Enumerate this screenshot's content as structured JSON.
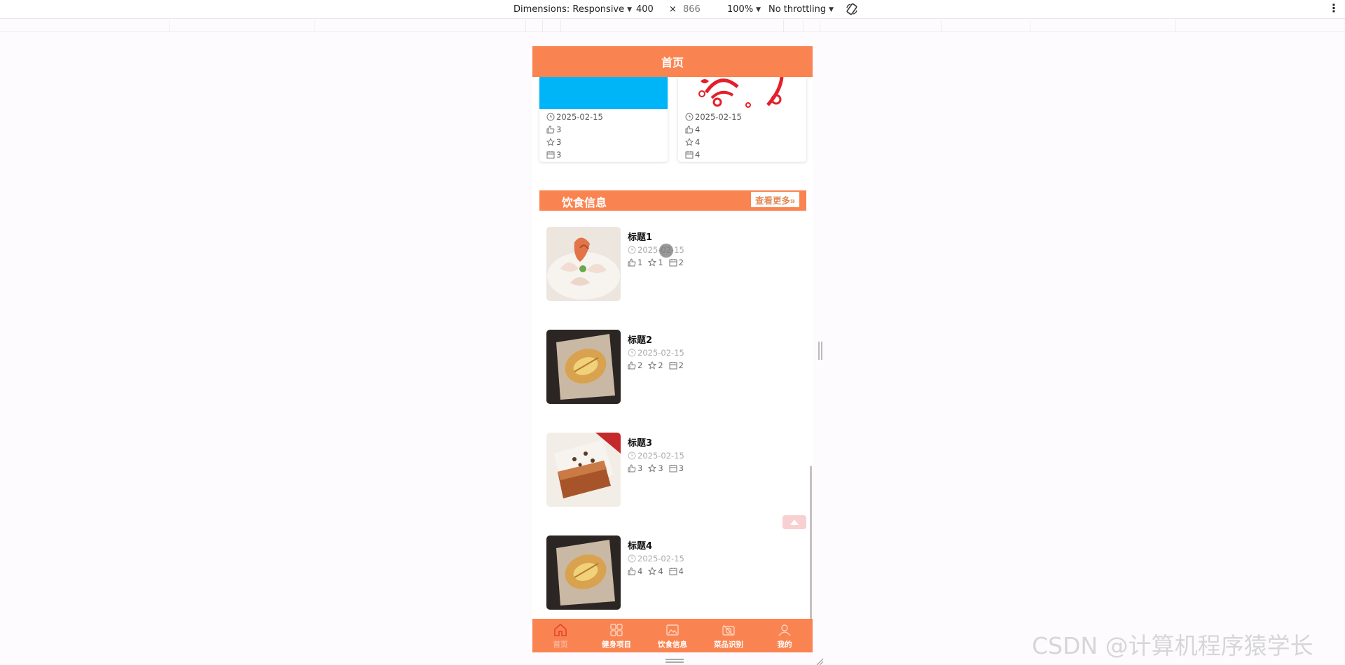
{
  "devtools": {
    "dimensions_label": "Dimensions: Responsive",
    "width": "400",
    "times": "×",
    "height": "866",
    "zoom": "100%",
    "throttling": "No throttling"
  },
  "header": {
    "title": "首页"
  },
  "cards": [
    {
      "date": "2025-02-15",
      "likes": "3",
      "favorites": "3",
      "views": "3",
      "image_color": "#00b4f8"
    },
    {
      "date": "2025-02-15",
      "likes": "4",
      "favorites": "4",
      "views": "4",
      "image_color": "#ffffff"
    }
  ],
  "section": {
    "title": "饮食信息",
    "more_label": "查看更多»"
  },
  "food_items": [
    {
      "title": "标题1",
      "date": "2025-02-15",
      "likes": "1",
      "favorites": "1",
      "views": "2"
    },
    {
      "title": "标题2",
      "date": "2025-02-15",
      "likes": "2",
      "favorites": "2",
      "views": "2"
    },
    {
      "title": "标题3",
      "date": "2025-02-15",
      "likes": "3",
      "favorites": "3",
      "views": "3"
    },
    {
      "title": "标题4",
      "date": "2025-02-15",
      "likes": "4",
      "favorites": "4",
      "views": "4"
    }
  ],
  "tabbar": [
    {
      "label": "首页",
      "icon": "home-icon"
    },
    {
      "label": "健身项目",
      "icon": "grid-icon"
    },
    {
      "label": "饮食信息",
      "icon": "picture-icon"
    },
    {
      "label": "菜品识别",
      "icon": "camera-icon"
    },
    {
      "label": "我的",
      "icon": "user-icon"
    }
  ],
  "watermark": "CSDN @计算机程序猿学长",
  "colors": {
    "accent": "#fa8451",
    "card_blue": "#00b4f8"
  }
}
